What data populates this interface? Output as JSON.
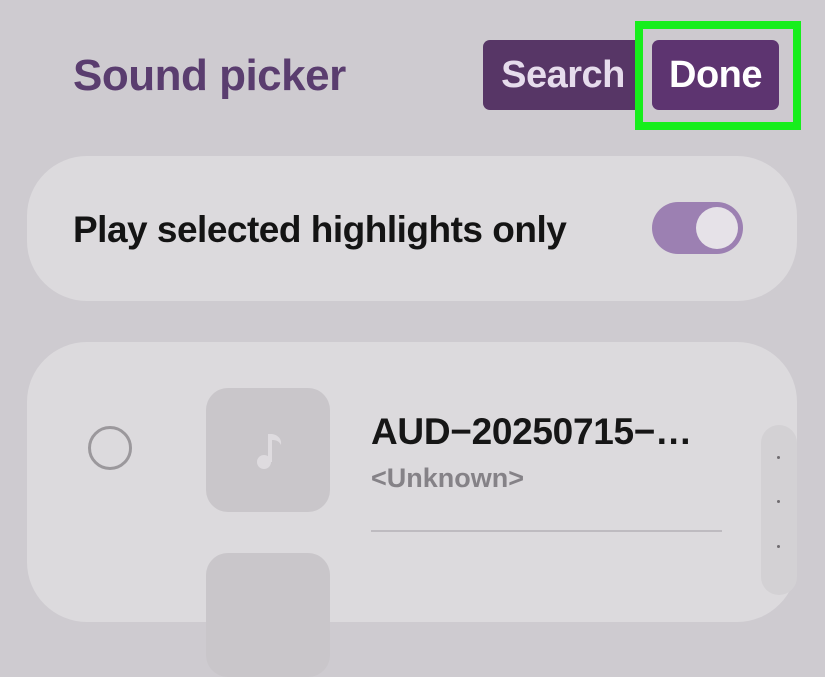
{
  "header": {
    "title": "Sound picker",
    "search_label": "Search",
    "done_label": "Done"
  },
  "toggle_option": {
    "label": "Play selected highlights only",
    "enabled": true
  },
  "tracks": [
    {
      "title": "AUD−20250715−…",
      "artist": "<Unknown>",
      "selected": false,
      "icon": "music-note-icon"
    }
  ],
  "colors": {
    "accent": "#5d3470",
    "title": "#5a3d6f",
    "toggle_on": "#9c80b2",
    "highlight": "#17ee1c"
  }
}
